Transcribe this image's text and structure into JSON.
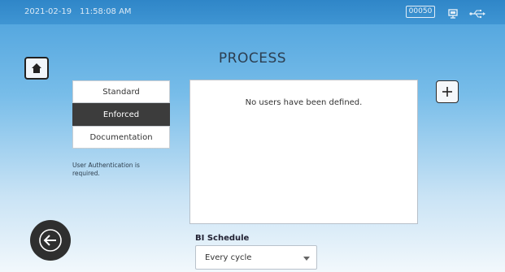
{
  "status_bar": {
    "date": "2021-02-19",
    "time": "11:58:08 AM",
    "counter": "00050",
    "icons": [
      "screen-icon",
      "usb-icon"
    ]
  },
  "header": {
    "title": "PROCESS",
    "home_icon": "home-icon",
    "add_icon": "plus-icon"
  },
  "auth_mode": {
    "options": [
      "Standard",
      "Enforced",
      "Documentation"
    ],
    "selected": "Enforced",
    "note": "User Authentication is required."
  },
  "users_panel": {
    "empty_message": "No users have been defined."
  },
  "bi_schedule": {
    "label": "BI Schedule",
    "value": "Every cycle"
  },
  "navigation": {
    "back_icon": "arrow-left-icon"
  },
  "colors": {
    "status_bar": "#2f86c8",
    "background_top": "#4aa0dc",
    "background_bottom": "#f2f8fc",
    "selected_option": "#3c3c3c",
    "back_button": "#2f2f2f"
  }
}
